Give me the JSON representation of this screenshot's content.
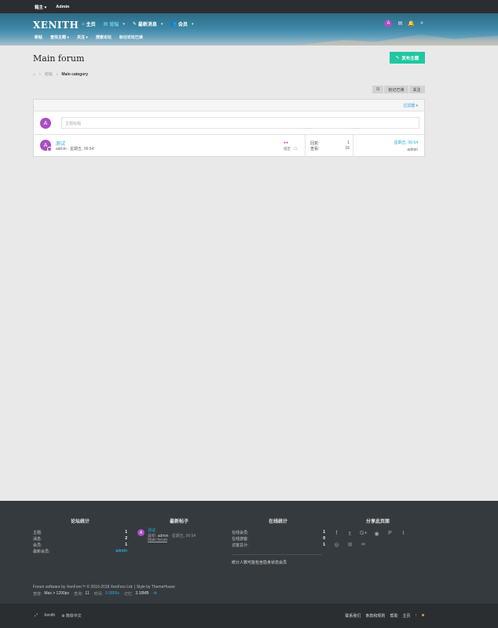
{
  "topbar": {
    "user": "箱主 ▾",
    "admin": "Admin"
  },
  "header": {
    "logo": "XENITH",
    "nav": [
      {
        "label": "主页",
        "icon": "⌂"
      },
      {
        "label": "论坛",
        "icon": "▤"
      },
      {
        "label": "最新消息",
        "icon": "✎"
      },
      {
        "label": "会员",
        "icon": "👥"
      }
    ],
    "avatar_letter": "A",
    "subnav": [
      "新帖",
      "查找主题",
      "关注",
      "搜索论坛",
      "标记论坛已读"
    ]
  },
  "page": {
    "title": "Main forum",
    "post_button": "发布主题",
    "breadcrumb": [
      "论坛",
      "Main category"
    ],
    "actions": [
      "☑",
      "标记已读",
      "关注"
    ],
    "filter": "过滤器 ▾",
    "quick_placeholder": "主题标题"
  },
  "thread": {
    "title": "测试",
    "meta": "admin · 星期五, 06:54",
    "flags": "●●",
    "lock_label": "锁定",
    "replies_label": "回复:",
    "replies": "1",
    "views_label": "查看:",
    "views": "16",
    "last_date": "星期五, 06:54",
    "last_user": "admin"
  },
  "footer": {
    "forum_stats_title": "论坛统计",
    "forum_stats": [
      {
        "label": "主题:",
        "value": "1"
      },
      {
        "label": "消息:",
        "value": "2"
      },
      {
        "label": "会员:",
        "value": "1"
      },
      {
        "label": "最新会员:",
        "value": "admin"
      }
    ],
    "latest_title": "最新帖子",
    "latest": {
      "title": "测试",
      "meta_prefix": "最新:",
      "meta_user": "admin",
      "meta_time": "· 星期五, 06:54",
      "forum": "Main forum"
    },
    "online_title": "在线统计",
    "online": [
      {
        "label": "在线会员:",
        "value": "1"
      },
      {
        "label": "在线游客:",
        "value": "0"
      },
      {
        "label": "访客总计:",
        "value": "1"
      }
    ],
    "online_note": "统计人数可能包含隐身状态会员",
    "share_title": "分享此页面",
    "share_icons": [
      "f",
      "𝕥",
      "G+",
      "◉",
      "P",
      "t",
      "◎",
      "✉",
      "∞"
    ],
    "copyright": "Forum software by XenForo™ © 2010-2018 XenForo Ltd. | Style by ThemeHouse",
    "perf": {
      "w_label": "宽度:",
      "w": "Max > 1200px",
      "q_label": "· 查询:",
      "q": "11",
      "t_label": "· 时间:",
      "t": "0.0856s",
      "m_label": "· 记忆:",
      "m": "3.18MB",
      "tail": "· ⚙"
    }
  },
  "bottombar": {
    "left": [
      "⤢",
      "Xenith",
      "⊕ 简体中文"
    ],
    "right": [
      "联系我们",
      "条款和规则",
      "帮助",
      "主页",
      "↑",
      "◙"
    ]
  }
}
